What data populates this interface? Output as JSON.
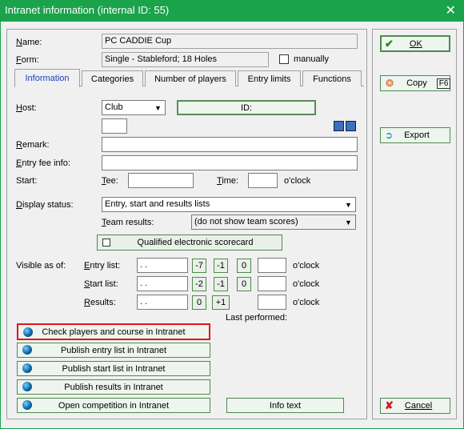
{
  "window": {
    "title": "Intranet information (internal ID: 55)",
    "close_glyph": "✕"
  },
  "name": {
    "label": "Name:",
    "value": "PC CADDIE Cup"
  },
  "form": {
    "label": "Form:",
    "value": "Single - Stableford; 18 Holes",
    "manually_label": "manually",
    "manually_checked": false
  },
  "tabs": [
    "Information",
    "Categories",
    "Number of players",
    "Entry limits",
    "Functions"
  ],
  "host": {
    "label": "Host:",
    "select_value": "Club",
    "id_button": "ID:",
    "small_value": ""
  },
  "remark": {
    "label": "Remark:",
    "value": ""
  },
  "entry_fee": {
    "label": "Entry fee info:",
    "value": ""
  },
  "start": {
    "label": "Start:",
    "tee_label": "Tee:",
    "tee_value": "",
    "time_label": "Time:",
    "time_value": "",
    "oclock": "o'clock"
  },
  "display_status": {
    "label": "Display status:",
    "value": "Entry, start and results lists"
  },
  "team_results": {
    "label": "Team results:",
    "value": "(do not show team scores)"
  },
  "scorecard": {
    "label": "Qualified electronic scorecard",
    "checked": false
  },
  "visible": {
    "label": "Visible as of:",
    "rows": [
      {
        "label": "Entry list:",
        "date": " .  .",
        "b1": "-7",
        "b2": "-1",
        "b3": "0",
        "time": "",
        "oclock": "o'clock"
      },
      {
        "label": "Start list:",
        "date": " .  .",
        "b1": "-2",
        "b2": "-1",
        "b3": "0",
        "time": "",
        "oclock": "o'clock"
      },
      {
        "label": "Results:",
        "date": " .  .",
        "b1": "0",
        "b2": "+1",
        "b3": "",
        "time": "",
        "oclock": "o'clock"
      }
    ],
    "last_performed": "Last performed:"
  },
  "actions": [
    "Check players and course in Intranet",
    "Publish entry list in Intranet",
    "Publish start list in Intranet",
    "Publish results in Intranet",
    "Open competition in Intranet"
  ],
  "info_text": "Info text",
  "right": {
    "ok": "OK",
    "copy": "Copy",
    "copy_key": "F6",
    "export": "Export",
    "cancel": "Cancel"
  },
  "colors": {
    "title_bar": "#1aa34a",
    "highlight_border": "#e0141c",
    "tab_active_text": "#1a3fbf"
  }
}
